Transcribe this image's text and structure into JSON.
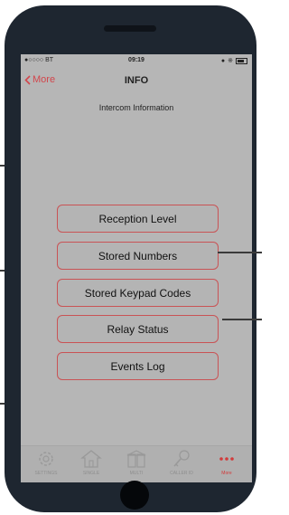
{
  "statusbar": {
    "carrier": "●○○○○ BT",
    "time": "09:19"
  },
  "navbar": {
    "back_label": "More",
    "title": "INFO"
  },
  "subtitle": "Intercom Information",
  "buttons": [
    {
      "label": "Reception Level"
    },
    {
      "label": "Stored Numbers"
    },
    {
      "label": "Stored Keypad Codes"
    },
    {
      "label": "Relay Status"
    },
    {
      "label": "Events Log"
    }
  ],
  "tabs": [
    {
      "label": "SETTINGS",
      "icon": "gear-icon"
    },
    {
      "label": "SINGLE",
      "icon": "house-icon"
    },
    {
      "label": "MULTI",
      "icon": "buildings-icon"
    },
    {
      "label": "CALLER ID",
      "icon": "key-icon"
    },
    {
      "label": "More",
      "icon": "more-dots-icon",
      "active": true
    }
  ],
  "colors": {
    "accent": "#d2464c",
    "button_border": "#c95355",
    "screen_bg": "#b6b6b6",
    "phone_body": "#1e2630"
  }
}
